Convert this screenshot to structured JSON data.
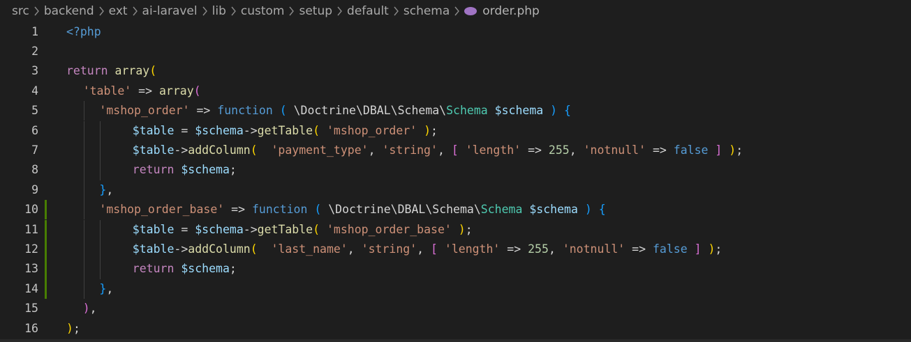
{
  "breadcrumb": {
    "items": [
      "src",
      "backend",
      "ext",
      "ai-laravel",
      "lib",
      "custom",
      "setup",
      "default",
      "schema"
    ],
    "file_name": "order.php",
    "file_icon": "php-elephant-icon",
    "separator": "chevron-right-icon"
  },
  "colors": {
    "background": "#1e1e1e",
    "keyword": "#c586c0",
    "function": "#dcdcaa",
    "string": "#ce9178",
    "variable": "#9cdcfe",
    "number": "#b5cea8",
    "class": "#4ec9b0",
    "bracket_1": "#ffd700",
    "bracket_2": "#da70d6",
    "bracket_3": "#179fff",
    "modified_gutter": "#487e02"
  },
  "editor": {
    "modified_lines": [
      10,
      11,
      12,
      13,
      14
    ],
    "lines": [
      {
        "n": "1",
        "indent": 0,
        "tokens": [
          {
            "t": "<?php",
            "c": "tag"
          }
        ]
      },
      {
        "n": "2",
        "indent": 0,
        "tokens": []
      },
      {
        "n": "3",
        "indent": 0,
        "tokens": [
          {
            "t": "return",
            "c": "kw"
          },
          {
            "t": " ",
            "c": "def"
          },
          {
            "t": "array",
            "c": "fn"
          },
          {
            "t": "(",
            "c": "b1"
          }
        ]
      },
      {
        "n": "4",
        "indent": 1,
        "tokens": [
          {
            "t": "'table'",
            "c": "str"
          },
          {
            "t": " => ",
            "c": "def"
          },
          {
            "t": "array",
            "c": "fn"
          },
          {
            "t": "(",
            "c": "b2"
          }
        ]
      },
      {
        "n": "5",
        "indent": 2,
        "tokens": [
          {
            "t": "'mshop_order'",
            "c": "str"
          },
          {
            "t": " => ",
            "c": "def"
          },
          {
            "t": "function",
            "c": "blue"
          },
          {
            "t": " ",
            "c": "def"
          },
          {
            "t": "(",
            "c": "b3"
          },
          {
            "t": " \\Doctrine\\DBAL\\Schema\\",
            "c": "def"
          },
          {
            "t": "Schema",
            "c": "cls"
          },
          {
            "t": " ",
            "c": "def"
          },
          {
            "t": "$schema",
            "c": "var"
          },
          {
            "t": " ",
            "c": "def"
          },
          {
            "t": ")",
            "c": "b3"
          },
          {
            "t": " ",
            "c": "def"
          },
          {
            "t": "{",
            "c": "b3"
          }
        ]
      },
      {
        "n": "6",
        "indent": 4,
        "tokens": [
          {
            "t": "$table",
            "c": "var"
          },
          {
            "t": " = ",
            "c": "def"
          },
          {
            "t": "$schema",
            "c": "var"
          },
          {
            "t": "->",
            "c": "def"
          },
          {
            "t": "getTable",
            "c": "fn"
          },
          {
            "t": "(",
            "c": "b1"
          },
          {
            "t": " ",
            "c": "def"
          },
          {
            "t": "'mshop_order'",
            "c": "str"
          },
          {
            "t": " ",
            "c": "def"
          },
          {
            "t": ")",
            "c": "b1"
          },
          {
            "t": ";",
            "c": "def"
          }
        ]
      },
      {
        "n": "7",
        "indent": 4,
        "tokens": [
          {
            "t": "$table",
            "c": "var"
          },
          {
            "t": "->",
            "c": "def"
          },
          {
            "t": "addColumn",
            "c": "fn"
          },
          {
            "t": "(",
            "c": "b1"
          },
          {
            "t": "  ",
            "c": "def"
          },
          {
            "t": "'payment_type'",
            "c": "str"
          },
          {
            "t": ", ",
            "c": "def"
          },
          {
            "t": "'string'",
            "c": "str"
          },
          {
            "t": ", ",
            "c": "def"
          },
          {
            "t": "[",
            "c": "b2"
          },
          {
            "t": " ",
            "c": "def"
          },
          {
            "t": "'length'",
            "c": "str"
          },
          {
            "t": " => ",
            "c": "def"
          },
          {
            "t": "255",
            "c": "num"
          },
          {
            "t": ", ",
            "c": "def"
          },
          {
            "t": "'notnull'",
            "c": "str"
          },
          {
            "t": " => ",
            "c": "def"
          },
          {
            "t": "false",
            "c": "blue"
          },
          {
            "t": " ",
            "c": "def"
          },
          {
            "t": "]",
            "c": "b2"
          },
          {
            "t": " ",
            "c": "def"
          },
          {
            "t": ")",
            "c": "b1"
          },
          {
            "t": ";",
            "c": "def"
          }
        ]
      },
      {
        "n": "8",
        "indent": 4,
        "tokens": [
          {
            "t": "return",
            "c": "kw"
          },
          {
            "t": " ",
            "c": "def"
          },
          {
            "t": "$schema",
            "c": "var"
          },
          {
            "t": ";",
            "c": "def"
          }
        ]
      },
      {
        "n": "9",
        "indent": 2,
        "tokens": [
          {
            "t": "}",
            "c": "b3"
          },
          {
            "t": ",",
            "c": "def"
          }
        ]
      },
      {
        "n": "10",
        "indent": 2,
        "tokens": [
          {
            "t": "'mshop_order_base'",
            "c": "str"
          },
          {
            "t": " => ",
            "c": "def"
          },
          {
            "t": "function",
            "c": "blue"
          },
          {
            "t": " ",
            "c": "def"
          },
          {
            "t": "(",
            "c": "b3"
          },
          {
            "t": " \\Doctrine\\DBAL\\Schema\\",
            "c": "def"
          },
          {
            "t": "Schema",
            "c": "cls"
          },
          {
            "t": " ",
            "c": "def"
          },
          {
            "t": "$schema",
            "c": "var"
          },
          {
            "t": " ",
            "c": "def"
          },
          {
            "t": ")",
            "c": "b3"
          },
          {
            "t": " ",
            "c": "def"
          },
          {
            "t": "{",
            "c": "b3"
          }
        ]
      },
      {
        "n": "11",
        "indent": 4,
        "tokens": [
          {
            "t": "$table",
            "c": "var"
          },
          {
            "t": " = ",
            "c": "def"
          },
          {
            "t": "$schema",
            "c": "var"
          },
          {
            "t": "->",
            "c": "def"
          },
          {
            "t": "getTable",
            "c": "fn"
          },
          {
            "t": "(",
            "c": "b1"
          },
          {
            "t": " ",
            "c": "def"
          },
          {
            "t": "'mshop_order_base'",
            "c": "str"
          },
          {
            "t": " ",
            "c": "def"
          },
          {
            "t": ")",
            "c": "b1"
          },
          {
            "t": ";",
            "c": "def"
          }
        ]
      },
      {
        "n": "12",
        "indent": 4,
        "tokens": [
          {
            "t": "$table",
            "c": "var"
          },
          {
            "t": "->",
            "c": "def"
          },
          {
            "t": "addColumn",
            "c": "fn"
          },
          {
            "t": "(",
            "c": "b1"
          },
          {
            "t": "  ",
            "c": "def"
          },
          {
            "t": "'last_name'",
            "c": "str"
          },
          {
            "t": ", ",
            "c": "def"
          },
          {
            "t": "'string'",
            "c": "str"
          },
          {
            "t": ", ",
            "c": "def"
          },
          {
            "t": "[",
            "c": "b2"
          },
          {
            "t": " ",
            "c": "def"
          },
          {
            "t": "'length'",
            "c": "str"
          },
          {
            "t": " => ",
            "c": "def"
          },
          {
            "t": "255",
            "c": "num"
          },
          {
            "t": ", ",
            "c": "def"
          },
          {
            "t": "'notnull'",
            "c": "str"
          },
          {
            "t": " => ",
            "c": "def"
          },
          {
            "t": "false",
            "c": "blue"
          },
          {
            "t": " ",
            "c": "def"
          },
          {
            "t": "]",
            "c": "b2"
          },
          {
            "t": " ",
            "c": "def"
          },
          {
            "t": ")",
            "c": "b1"
          },
          {
            "t": ";",
            "c": "def"
          }
        ]
      },
      {
        "n": "13",
        "indent": 4,
        "tokens": [
          {
            "t": "return",
            "c": "kw"
          },
          {
            "t": " ",
            "c": "def"
          },
          {
            "t": "$schema",
            "c": "var"
          },
          {
            "t": ";",
            "c": "def"
          }
        ]
      },
      {
        "n": "14",
        "indent": 2,
        "tokens": [
          {
            "t": "}",
            "c": "b3"
          },
          {
            "t": ",",
            "c": "def"
          }
        ]
      },
      {
        "n": "15",
        "indent": 1,
        "tokens": [
          {
            "t": ")",
            "c": "b2"
          },
          {
            "t": ",",
            "c": "def"
          }
        ]
      },
      {
        "n": "16",
        "indent": 0,
        "tokens": [
          {
            "t": ")",
            "c": "b1"
          },
          {
            "t": ";",
            "c": "def"
          }
        ]
      }
    ]
  }
}
